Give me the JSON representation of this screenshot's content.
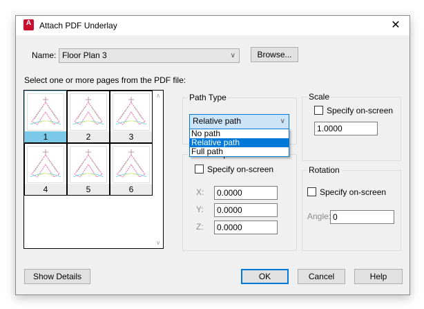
{
  "window": {
    "title": "Attach PDF Underlay",
    "app_icon": "autocad-icon",
    "app_icon_letter": "A",
    "close": "✕"
  },
  "name": {
    "label": "Name:",
    "value": "Floor Plan 3",
    "browse": "Browse..."
  },
  "pages": {
    "label": "Select one or more pages from the PDF file:",
    "items": [
      "1",
      "2",
      "3",
      "4",
      "5",
      "6"
    ],
    "selected": "1"
  },
  "path_type": {
    "label": "Path Type",
    "value": "Relative path",
    "options": [
      "No path",
      "Relative path",
      "Full path"
    ],
    "highlighted": "Relative path"
  },
  "insertion": {
    "label": "Insertion point",
    "specify": "Specify on-screen",
    "x_label": "X:",
    "x": "0.0000",
    "y_label": "Y:",
    "y": "0.0000",
    "z_label": "Z:",
    "z": "0.0000"
  },
  "scale": {
    "label": "Scale",
    "specify": "Specify on-screen",
    "value": "1.0000"
  },
  "rotation": {
    "label": "Rotation",
    "specify": "Specify on-screen",
    "angle_label": "Angle:",
    "angle": "0"
  },
  "buttons": {
    "show_details": "Show Details",
    "ok": "OK",
    "cancel": "Cancel",
    "help": "Help"
  }
}
